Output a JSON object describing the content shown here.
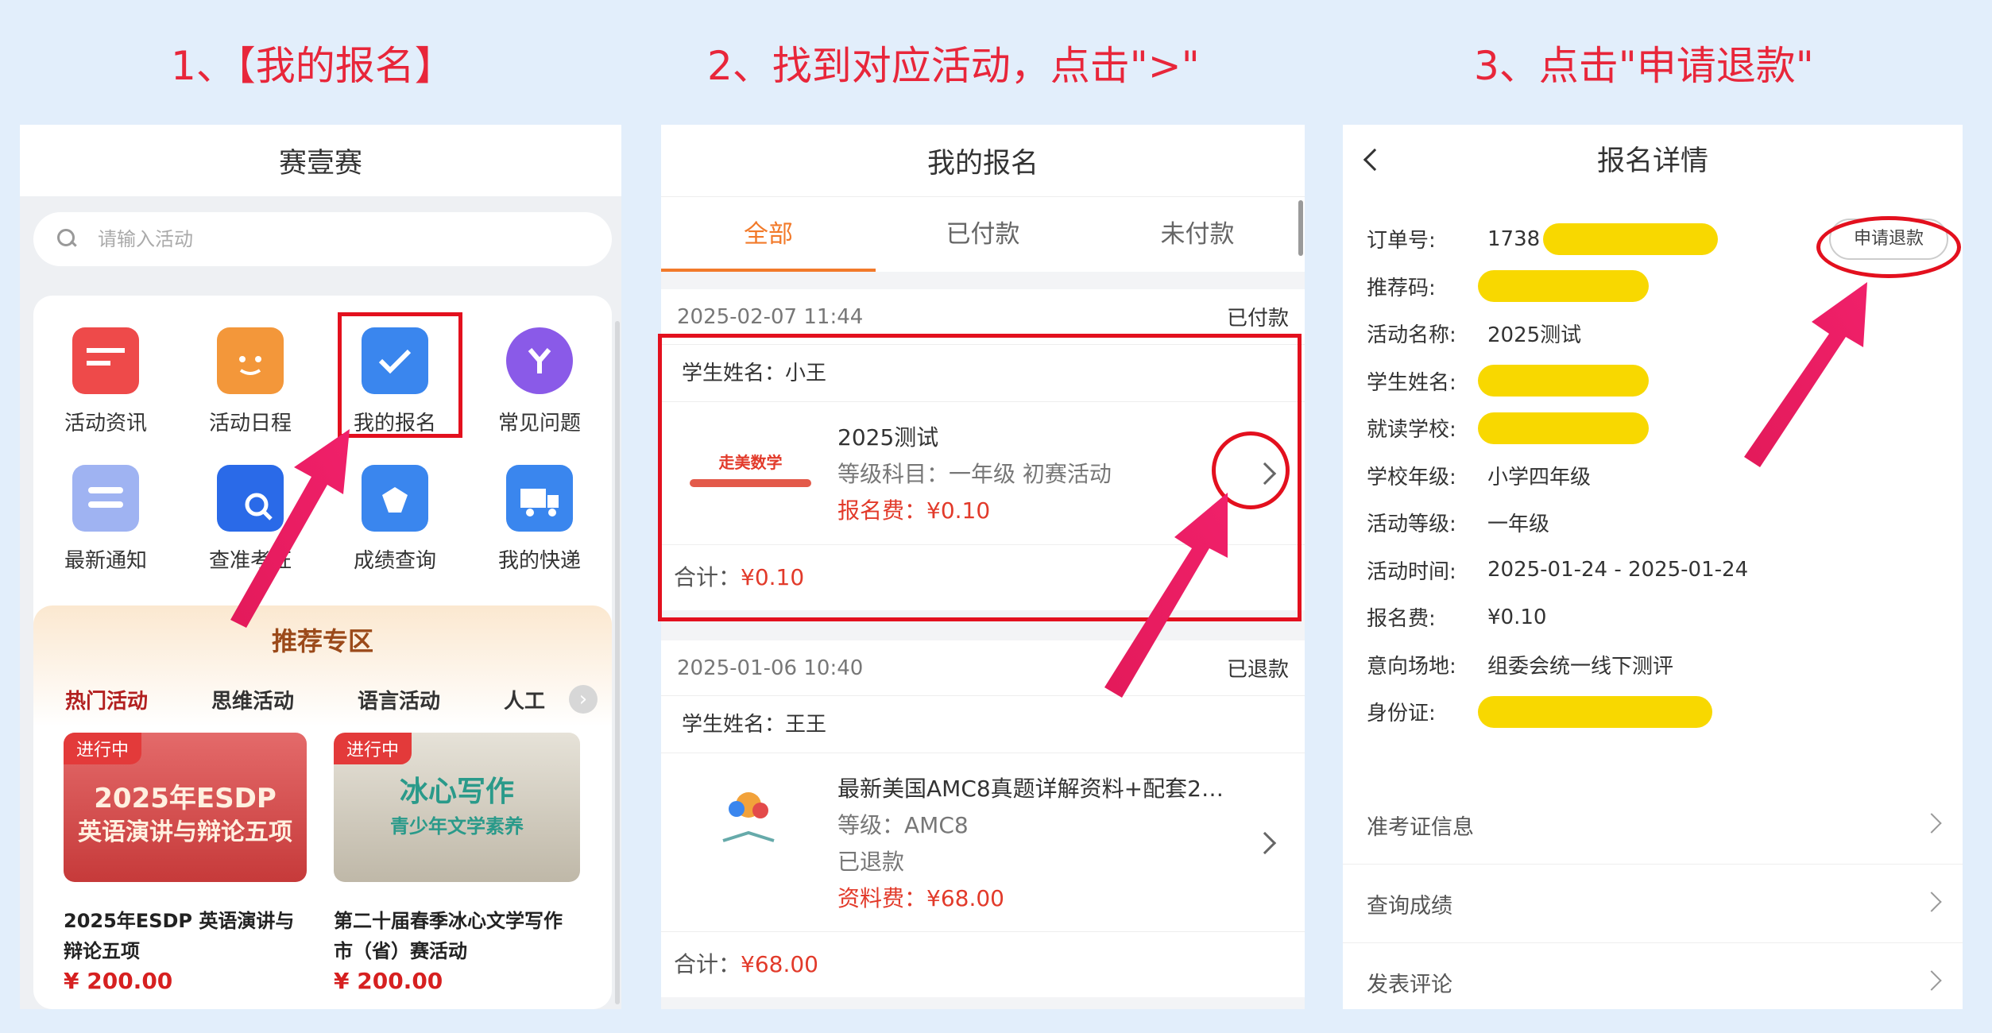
{
  "steps": [
    "1、【我的报名】",
    "2、找到对应活动，点击\">\"",
    "3、点击\"申请退款\""
  ],
  "panel1": {
    "title": "赛壹赛",
    "search_placeholder": "请输入活动",
    "icons": [
      {
        "label": "活动资讯",
        "icon": "news-icon",
        "color": "#ee4a4a"
      },
      {
        "label": "活动日程",
        "icon": "calendar-icon",
        "color": "#f3973a"
      },
      {
        "label": "我的报名",
        "icon": "signup-check-icon",
        "color": "#3a86ee"
      },
      {
        "label": "常见问题",
        "icon": "faq-icon",
        "color": "#8a5ae8"
      },
      {
        "label": "最新通知",
        "icon": "notice-icon",
        "color": "#8ea5f0"
      },
      {
        "label": "查准考证",
        "icon": "ticket-search-icon",
        "color": "#2a6ae8"
      },
      {
        "label": "成绩查询",
        "icon": "score-icon",
        "color": "#3a86ee"
      },
      {
        "label": "我的快递",
        "icon": "truck-icon",
        "color": "#3a86ee"
      }
    ],
    "recommend_title": "推荐专区",
    "rec_tabs": [
      "热门活动",
      "思维活动",
      "语言活动",
      "人工"
    ],
    "cards": [
      {
        "badge": "进行中",
        "img_line1": "2025年ESDP",
        "img_line2": "英语演讲与辩论五项",
        "name": "2025年ESDP 英语演讲与辩论五项",
        "price": "¥ 200.00"
      },
      {
        "badge": "进行中",
        "img_line1": "冰心写作",
        "img_line2": "青少年文学素养",
        "name": "第二十届春季冰心文学写作市（省）赛活动",
        "price": "¥ 200.00"
      }
    ]
  },
  "panel2": {
    "title": "我的报名",
    "tabs": [
      "全部",
      "已付款",
      "未付款"
    ],
    "orders": [
      {
        "time": "2025-02-07 11:44",
        "status": "已付款",
        "student": "学生姓名：小王",
        "thumb_text": "走美数学",
        "line1": "2025测试",
        "line2": "等级科目：一年级   初赛活动",
        "line3": "",
        "fee": "报名费：¥0.10",
        "total_label": "合计：",
        "total": "¥0.10"
      },
      {
        "time": "2025-01-06 10:40",
        "status": "已退款",
        "student": "学生姓名：王王",
        "thumb_text": "",
        "line1": "最新美国AMC8真题详解资料+配套2…",
        "line2": "等级：AMC8",
        "line3": "已退款",
        "fee": "资料费：¥68.00",
        "total_label": "合计：",
        "total": "¥68.00"
      }
    ]
  },
  "panel3": {
    "title": "报名详情",
    "refund_button": "申请退款",
    "rows": [
      {
        "k": "订单号:",
        "v": "1738"
      },
      {
        "k": "推荐码:",
        "v": ""
      },
      {
        "k": "活动名称:",
        "v": "2025测试"
      },
      {
        "k": "学生姓名:",
        "v": ""
      },
      {
        "k": "就读学校:",
        "v": ""
      },
      {
        "k": "学校年级:",
        "v": "小学四年级"
      },
      {
        "k": "活动等级:",
        "v": "一年级"
      },
      {
        "k": "活动时间:",
        "v": "2025-01-24 - 2025-01-24"
      },
      {
        "k": "报名费:",
        "v": "¥0.10"
      },
      {
        "k": "意向场地:",
        "v": "组委会统一线下测评"
      },
      {
        "k": "身份证:",
        "v": ""
      }
    ],
    "links": [
      "准考证信息",
      "查询成绩",
      "发表评论"
    ]
  },
  "colors": {
    "accent": "#f27a2a",
    "annotation": "#e3101e",
    "highlight": "#f8d800",
    "fee": "#e23a2a"
  }
}
